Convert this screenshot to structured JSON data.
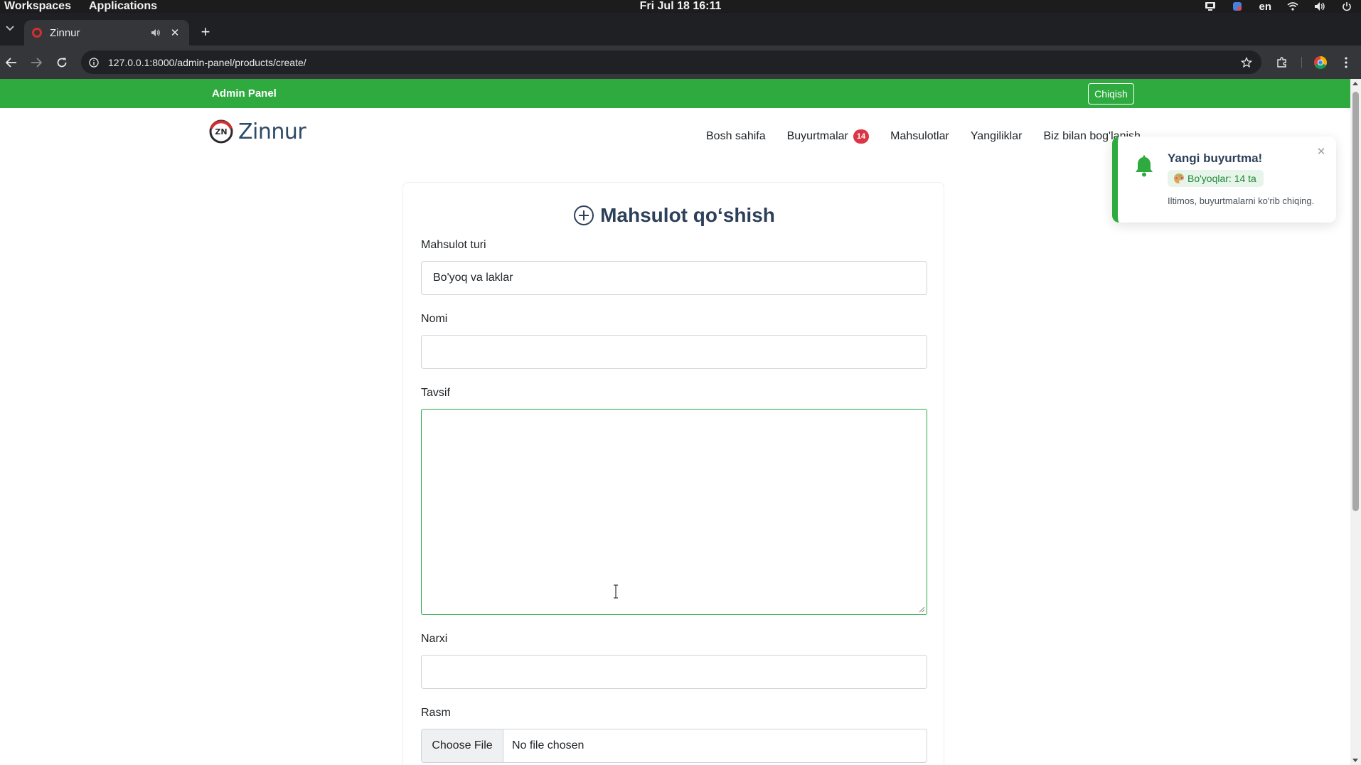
{
  "os": {
    "workspaces": "Workspaces",
    "applications": "Applications",
    "datetime": "Fri Jul 18  16:11",
    "lang": "en"
  },
  "browser": {
    "tab_title": "Zinnur",
    "url": "127.0.0.1:8000/admin-panel/products/create/"
  },
  "admin_bar": {
    "title": "Admin Panel",
    "logout": "Chiqish",
    "color": "#2eaa3f"
  },
  "navbar": {
    "brand": "Zinnur",
    "logo_text": "ZN",
    "links": [
      {
        "label": "Bosh sahifa"
      },
      {
        "label": "Buyurtmalar",
        "badge": "14"
      },
      {
        "label": "Mahsulotlar"
      },
      {
        "label": "Yangiliklar"
      },
      {
        "label": "Biz bilan bog'lanish"
      }
    ]
  },
  "form": {
    "title": "Mahsulot qo‘shish",
    "fields": {
      "type": {
        "label": "Mahsulot turi",
        "value": "Bo'yoq va laklar"
      },
      "name": {
        "label": "Nomi",
        "value": ""
      },
      "description": {
        "label": "Tavsif",
        "value": ""
      },
      "price": {
        "label": "Narxi",
        "value": ""
      },
      "image": {
        "label": "Rasm",
        "button": "Choose File",
        "status": "No file chosen"
      }
    }
  },
  "toast": {
    "title": "Yangi buyurtma!",
    "chip": "Bo'yoqlar: 14 ta",
    "message": "Iltimos, buyurtmalarni ko'rib chiqing.",
    "accent": "#2eaa3f"
  }
}
